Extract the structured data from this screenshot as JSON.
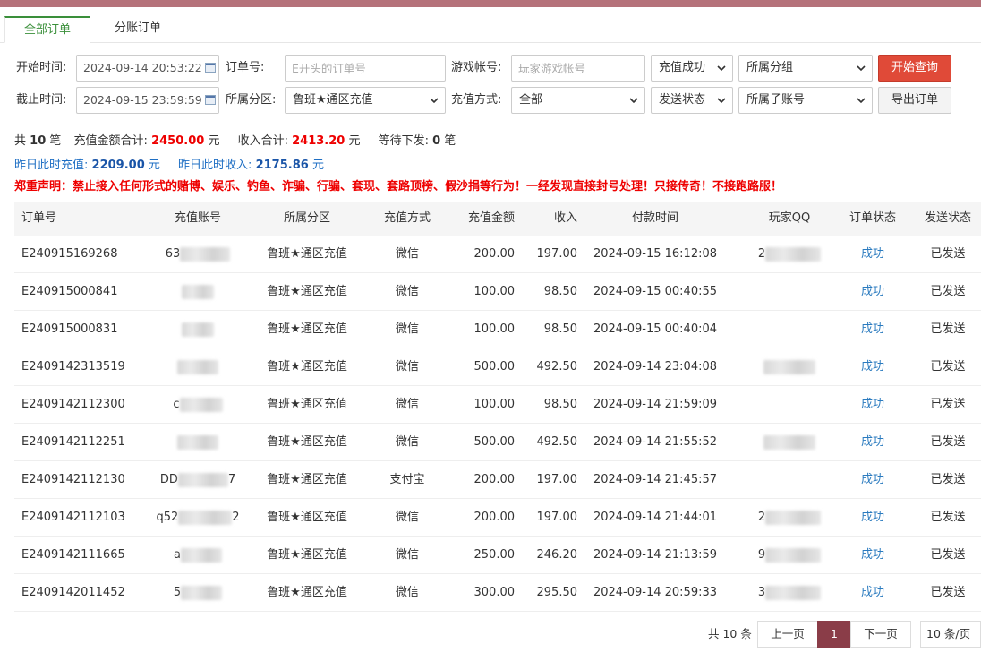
{
  "tabs": [
    {
      "label": "全部订单",
      "active": true
    },
    {
      "label": "分账订单",
      "active": false
    }
  ],
  "filters": {
    "start_label": "开始时间:",
    "start_value": "2024-09-14 20:53:22",
    "end_label": "截止时间:",
    "end_value": "2024-09-15 23:59:59",
    "order_label": "订单号:",
    "order_placeholder": "E开头的订单号",
    "zone_label": "所属分区:",
    "zone_value": "鲁班★通区充值",
    "game_acc_label": "游戏帐号:",
    "game_acc_placeholder": "玩家游戏帐号",
    "pay_label": "充值方式:",
    "pay_value": "全部",
    "recharge_status": "充值成功",
    "send_status": "发送状态",
    "group": "所属分组",
    "sub_account": "所属子账号",
    "search_button": "开始查询",
    "export_button": "导出订单"
  },
  "summary": {
    "total_prefix": "共",
    "total_count": "10",
    "total_suffix": "笔",
    "amount_label": "充值金额合计:",
    "amount_value": "2450.00",
    "amount_unit": "元",
    "income_label": "收入合计:",
    "income_value": "2413.20",
    "income_unit": "元",
    "pending_label": "等待下发:",
    "pending_value": "0",
    "pending_unit": "笔",
    "yesterday_recharge_label": "昨日此时充值:",
    "yesterday_recharge_value": "2209.00",
    "yesterday_recharge_unit": "元",
    "yesterday_income_label": "昨日此时收入:",
    "yesterday_income_value": "2175.86",
    "yesterday_income_unit": "元",
    "warning": "郑重声明：禁止接入任何形式的赌博、娱乐、钓鱼、诈骗、行骗、套现、套路顶榜、假沙捐等行为！一经发现直接封号处理！只接传奇！不接跑路服！"
  },
  "table": {
    "headers": [
      "订单号",
      "充值账号",
      "所属分区",
      "充值方式",
      "充值金额",
      "收入",
      "付款时间",
      "玩家QQ",
      "订单状态",
      "发送状态"
    ],
    "rows": [
      {
        "order": "E240915169268",
        "acc_prefix": "63",
        "acc_suffix": "",
        "zone": "鲁班★通区充值",
        "pay": "微信",
        "amount": "200.00",
        "income": "197.00",
        "time": "2024-09-15 16:12:08",
        "qq_prefix": "2",
        "status": "成功",
        "send": "已发送"
      },
      {
        "order": "E240915000841",
        "acc_prefix": "",
        "acc_suffix": "",
        "zone": "鲁班★通区充值",
        "pay": "微信",
        "amount": "100.00",
        "income": "98.50",
        "time": "2024-09-15 00:40:55",
        "qq_prefix": "",
        "status": "成功",
        "send": "已发送"
      },
      {
        "order": "E240915000831",
        "acc_prefix": "",
        "acc_suffix": "",
        "zone": "鲁班★通区充值",
        "pay": "微信",
        "amount": "100.00",
        "income": "98.50",
        "time": "2024-09-15 00:40:04",
        "qq_prefix": "",
        "status": "成功",
        "send": "已发送"
      },
      {
        "order": "E2409142313519",
        "acc_prefix": "",
        "acc_suffix": "",
        "zone": "鲁班★通区充值",
        "pay": "微信",
        "amount": "500.00",
        "income": "492.50",
        "time": "2024-09-14 23:04:08",
        "qq_prefix": "",
        "status": "成功",
        "send": "已发送"
      },
      {
        "order": "E2409142112300",
        "acc_prefix": "c",
        "acc_suffix": "",
        "zone": "鲁班★通区充值",
        "pay": "微信",
        "amount": "100.00",
        "income": "98.50",
        "time": "2024-09-14 21:59:09",
        "qq_prefix": "",
        "status": "成功",
        "send": "已发送"
      },
      {
        "order": "E2409142112251",
        "acc_prefix": "",
        "acc_suffix": "",
        "zone": "鲁班★通区充值",
        "pay": "微信",
        "amount": "500.00",
        "income": "492.50",
        "time": "2024-09-14 21:55:52",
        "qq_prefix": "",
        "status": "成功",
        "send": "已发送"
      },
      {
        "order": "E2409142112130",
        "acc_prefix": "DD",
        "acc_suffix": "7",
        "zone": "鲁班★通区充值",
        "pay": "支付宝",
        "amount": "200.00",
        "income": "197.00",
        "time": "2024-09-14 21:45:57",
        "qq_prefix": "",
        "status": "成功",
        "send": "已发送"
      },
      {
        "order": "E2409142112103",
        "acc_prefix": "q52",
        "acc_suffix": "2",
        "zone": "鲁班★通区充值",
        "pay": "微信",
        "amount": "200.00",
        "income": "197.00",
        "time": "2024-09-14 21:44:01",
        "qq_prefix": "2",
        "status": "成功",
        "send": "已发送"
      },
      {
        "order": "E2409142111665",
        "acc_prefix": "a",
        "acc_suffix": "",
        "zone": "鲁班★通区充值",
        "pay": "微信",
        "amount": "250.00",
        "income": "246.20",
        "time": "2024-09-14 21:13:59",
        "qq_prefix": "9",
        "status": "成功",
        "send": "已发送"
      },
      {
        "order": "E2409142011452",
        "acc_prefix": "5",
        "acc_suffix": "",
        "zone": "鲁班★通区充值",
        "pay": "微信",
        "amount": "300.00",
        "income": "295.50",
        "time": "2024-09-14 20:59:33",
        "qq_prefix": "3",
        "status": "成功",
        "send": "已发送"
      }
    ]
  },
  "pagination": {
    "total": "共 10 条",
    "prev": "上一页",
    "current": "1",
    "next": "下一页",
    "page_size": "10 条/页"
  },
  "colors": {
    "topbar": "#b5727a",
    "accent_green": "#3a8f3a",
    "search_button": "#e04a38",
    "highlight_red": "#ee0000",
    "link_blue": "#2b7bbf",
    "page_current": "#8a3d48"
  }
}
